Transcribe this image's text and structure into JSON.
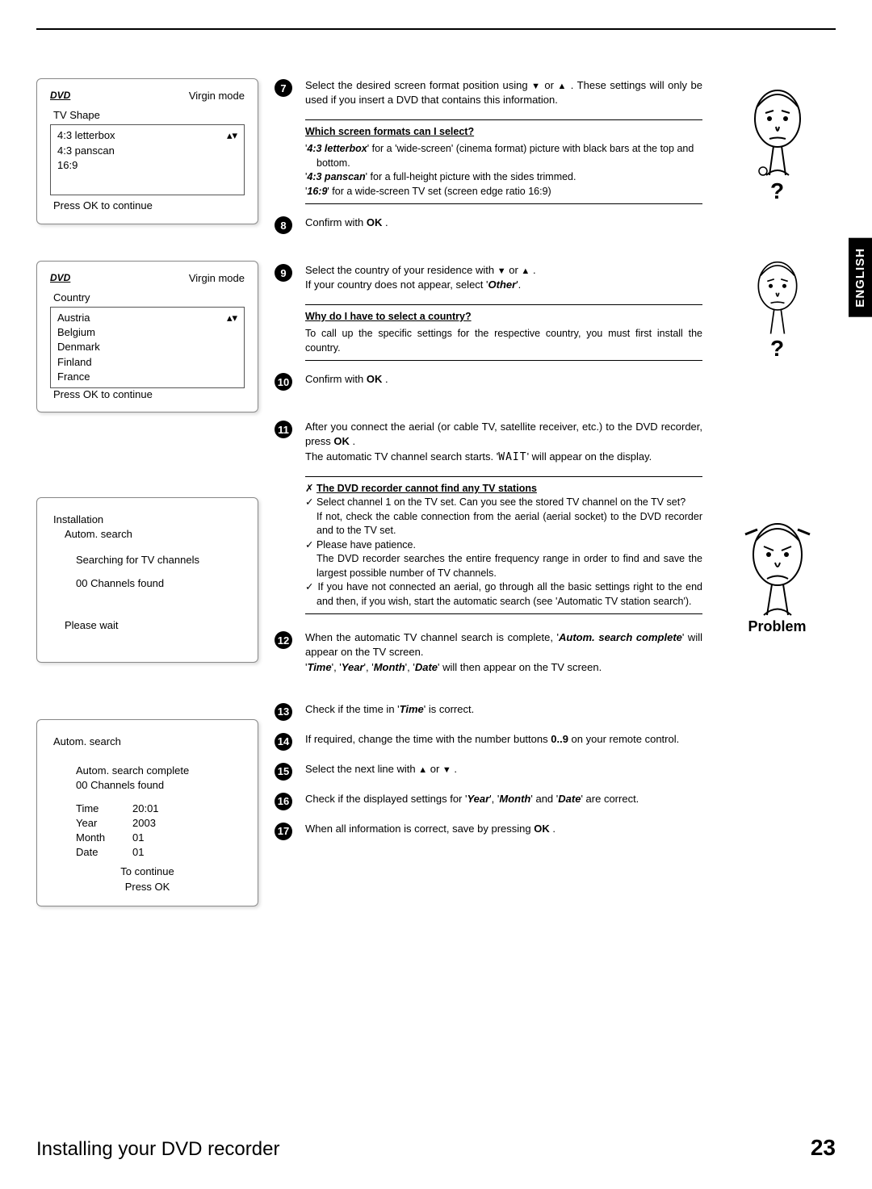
{
  "language_tab": "ENGLISH",
  "footer": {
    "title": "Installing your DVD recorder",
    "page": "23"
  },
  "osd_tvshape": {
    "mode": "Virgin mode",
    "title": "TV Shape",
    "items": [
      "4:3 letterbox",
      "4:3 panscan",
      "16:9"
    ],
    "footer": "Press OK to continue",
    "updown": "▴▾"
  },
  "osd_country": {
    "mode": "Virgin mode",
    "title": "Country",
    "items": [
      "Austria",
      "Belgium",
      "Denmark",
      "Finland",
      "France"
    ],
    "footer": "Press OK to continue",
    "updown": "▴▾"
  },
  "osd_search": {
    "title": "Installation",
    "subtitle": "Autom. search",
    "line1": "Searching for TV channels",
    "line2": "00 Channels found",
    "wait": "Please wait"
  },
  "osd_clock": {
    "title": "Autom. search",
    "line1": "Autom. search complete",
    "line2": "00 Channels found",
    "rows": [
      {
        "k": "Time",
        "v": "20:01"
      },
      {
        "k": "Year",
        "v": "2003"
      },
      {
        "k": "Month",
        "v": "01"
      },
      {
        "k": "Date",
        "v": "01"
      }
    ],
    "foot1": "To continue",
    "foot2": "Press OK"
  },
  "steps": {
    "s7": {
      "num": "7",
      "text_a": "Select the desired screen format position using ",
      "text_b": " or ",
      "text_c": " . These settings will only be used if you insert a DVD that contains this information.",
      "down": "▼",
      "up": "▲"
    },
    "s8": {
      "num": "8",
      "text_a": "Confirm with ",
      "ok": "OK",
      "text_b": " ."
    },
    "s9": {
      "num": "9",
      "line1_a": "Select the country of your residence with ",
      "line1_b": " or ",
      "line1_c": " .",
      "down": "▼",
      "up": "▲",
      "line2_a": "If your country does not appear, select '",
      "other": "Other",
      "line2_b": "'."
    },
    "s10": {
      "num": "10",
      "text_a": "Confirm with ",
      "ok": "OK",
      "text_b": " ."
    },
    "s11": {
      "num": "11",
      "p1_a": "After you connect the aerial (or cable TV, satellite receiver, etc.) to the DVD recorder, press ",
      "ok": "OK",
      "p1_b": " .",
      "p2_a": "The automatic TV channel search starts. '",
      "wait": "WAIT",
      "p2_b": "' will appear on the display."
    },
    "s12": {
      "num": "12",
      "p1_a": "When the automatic TV channel search is complete, '",
      "b1": "Autom. search complete",
      "p1_b": "' will appear on the TV screen.",
      "p2_a": "'",
      "t": "Time",
      "p2_b": "', '",
      "y": "Year",
      "p2_c": "', '",
      "m": "Month",
      "p2_d": "', '",
      "d": "Date",
      "p2_e": "' will then appear on the TV screen."
    },
    "s13": {
      "num": "13",
      "text_a": "Check if the time in '",
      "time": "Time",
      "text_b": "' is correct."
    },
    "s14": {
      "num": "14",
      "text_a": "If required, change the time with the number buttons ",
      "keys": "0..9",
      "text_b": " on your remote control."
    },
    "s15": {
      "num": "15",
      "text_a": "Select the next line with ",
      "up": "▲",
      "text_b": " or ",
      "down": "▼",
      "text_c": " ."
    },
    "s16": {
      "num": "16",
      "text_a": "Check if the displayed settings for '",
      "y": "Year",
      "text_b": "', '",
      "m": "Month",
      "text_c": "' and '",
      "d": "Date",
      "text_d": "' are correct."
    },
    "s17": {
      "num": "17",
      "text_a": "When all information is correct, save by pressing ",
      "ok": "OK",
      "text_b": " ."
    }
  },
  "faq1": {
    "title": "Which screen formats can I select?",
    "l1_a": "'",
    "l1_b": "4:3 letterbox",
    "l1_c": "' for a 'wide-screen' (cinema format) picture with black bars at the top and bottom.",
    "l2_a": "'",
    "l2_b": "4:3 panscan",
    "l2_c": "' for a full-height picture with the sides trimmed.",
    "l3_a": "'",
    "l3_b": "16:9",
    "l3_c": "' for a wide-screen TV set (screen edge ratio 16:9)",
    "mark": "?"
  },
  "faq2": {
    "title": "Why do I have to select a country?",
    "text": "To call up the specific settings for the respective country, you must first install the country.",
    "mark": "?"
  },
  "faq3": {
    "title_pre": "✗ ",
    "title": "The DVD recorder cannot find any TV stations",
    "b1_a": "✓ Select channel 1 on the TV set. Can you see the stored TV channel on the TV set?",
    "b1_b": "If not, check the cable connection from the aerial (aerial socket) to the DVD recorder and to the TV set.",
    "b2_a": "✓ Please have patience.",
    "b2_b": "The DVD recorder searches the entire frequency range in order to find and save the largest possible number of TV channels.",
    "b3": "✓ If you have not connected an aerial, go through all the basic settings right to the end and then, if you wish, start the automatic search (see 'Automatic TV station search').",
    "label": "Problem"
  }
}
